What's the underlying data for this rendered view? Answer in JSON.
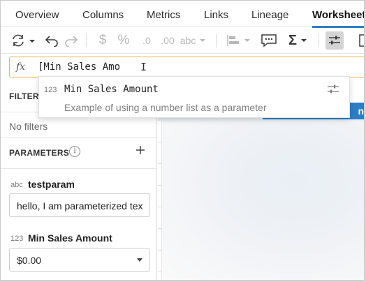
{
  "tabs": [
    {
      "label": "Overview"
    },
    {
      "label": "Columns"
    },
    {
      "label": "Metrics"
    },
    {
      "label": "Links"
    },
    {
      "label": "Lineage"
    },
    {
      "label": "Worksheet",
      "active": true
    }
  ],
  "toolbar": {
    "dollar": "$",
    "percent": "%",
    "decrease_decimals": ".0",
    "increase_decimals": ".00",
    "text_format": "abc",
    "sigma": "Σ"
  },
  "formula_bar": {
    "fx": "fx",
    "value": "[Min Sales Amo"
  },
  "autocomplete": {
    "type": "123",
    "name": "Min Sales Amount",
    "description": "Example of using a number list as a parameter"
  },
  "panel": {
    "filters_heading": "FILTERS",
    "no_filters": "No filters",
    "parameters_heading": "PARAMETERS",
    "parameters": [
      {
        "type": "abc",
        "name": "testparam",
        "value": "hello, I am parameterized tex"
      },
      {
        "type": "123",
        "name": "Min Sales Amount",
        "value": "$0.00"
      }
    ]
  },
  "canvas": {
    "button_fragment": "n"
  },
  "colors": {
    "accent": "#2c7ec4",
    "formula_border": "#e9b64a"
  }
}
